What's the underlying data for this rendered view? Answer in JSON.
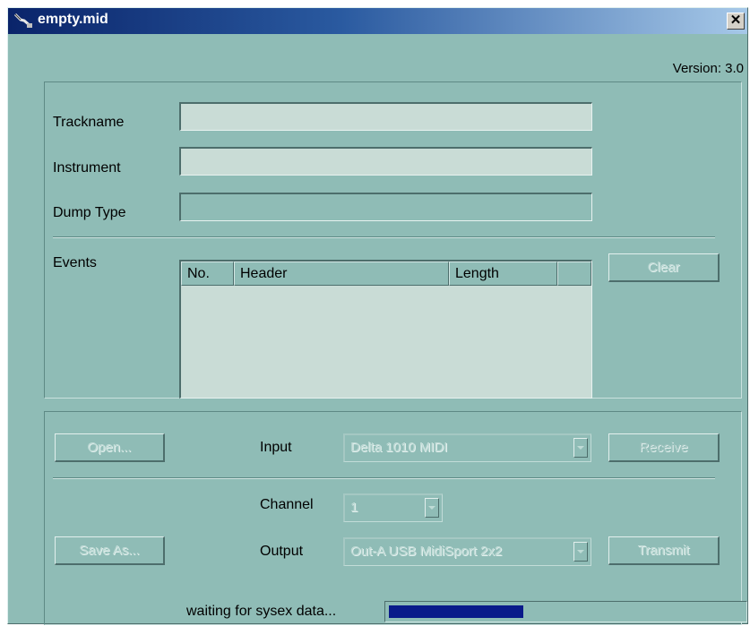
{
  "window": {
    "title": "empty.mid",
    "close_symbol": "✕",
    "version": "Version: 3.0"
  },
  "fields": {
    "trackname_label": "Trackname",
    "trackname_value": "",
    "instrument_label": "Instrument",
    "instrument_value": "",
    "dump_type_label": "Dump Type",
    "dump_type_value": ""
  },
  "events": {
    "label": "Events",
    "columns": [
      "No.",
      "Header",
      "Length"
    ],
    "rows": [],
    "clear_button": "Clear"
  },
  "io": {
    "open_button": "Open...",
    "input_label": "Input",
    "input_value": "Delta 1010 MIDI",
    "receive_button": "Receive",
    "channel_label": "Channel",
    "channel_value": "1",
    "save_as_button": "Save As...",
    "output_label": "Output",
    "output_value": "Out-A USB MidiSport 2x2",
    "transmit_button": "Transmit"
  },
  "status": {
    "text": "waiting for sysex data...",
    "progress_fraction": 0.38,
    "progress_color": "#0a1a8a"
  },
  "icons": {
    "app": "midi-cable-icon",
    "dropdown": "chevron-down-icon"
  },
  "colors": {
    "window_bg": "#8fbcb6",
    "titlebar_start": "#0a246a",
    "titlebar_end": "#a6c8e8"
  }
}
